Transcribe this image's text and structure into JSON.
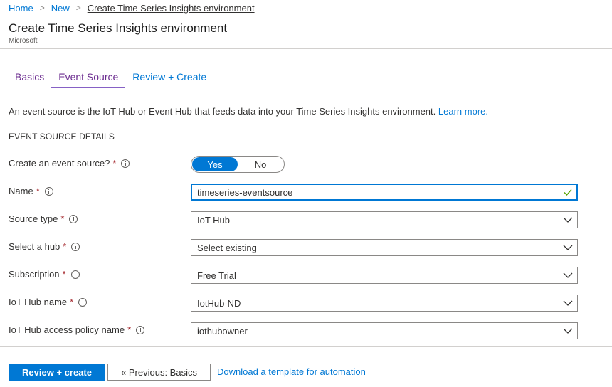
{
  "breadcrumb": {
    "items": [
      "Home",
      "New"
    ],
    "current": "Create Time Series Insights environment"
  },
  "header": {
    "title": "Create Time Series Insights environment",
    "publisher": "Microsoft"
  },
  "tabs": [
    {
      "label": "Basics"
    },
    {
      "label": "Event Source"
    },
    {
      "label": "Review + Create"
    }
  ],
  "description": {
    "text": "An event source is the IoT Hub or Event Hub that feeds data into your Time Series Insights environment.",
    "link": "Learn more."
  },
  "section_heading": "EVENT SOURCE DETAILS",
  "form": {
    "create_event_source": {
      "label": "Create an event source?",
      "required": "*",
      "options": [
        "Yes",
        "No"
      ],
      "selected": "Yes"
    },
    "name": {
      "label": "Name",
      "required": "*",
      "value": "timeseries-eventsource"
    },
    "source_type": {
      "label": "Source type",
      "required": "*",
      "value": "IoT Hub"
    },
    "select_hub": {
      "label": "Select a hub",
      "required": "*",
      "value": "Select existing"
    },
    "subscription": {
      "label": "Subscription",
      "required": "*",
      "value": "Free Trial"
    },
    "iot_hub_name": {
      "label": "IoT Hub name",
      "required": "*",
      "value": "IotHub-ND"
    },
    "access_policy": {
      "label": "IoT Hub access policy name",
      "required": "*",
      "value": "iothubowner"
    }
  },
  "footer": {
    "primary": "Review + create",
    "previous": "« Previous: Basics",
    "template_link": "Download a template for automation"
  },
  "colors": {
    "accent": "#0078d4",
    "tab_text": "#6b2b8f",
    "required": "#a4262c",
    "valid": "#57a300"
  }
}
